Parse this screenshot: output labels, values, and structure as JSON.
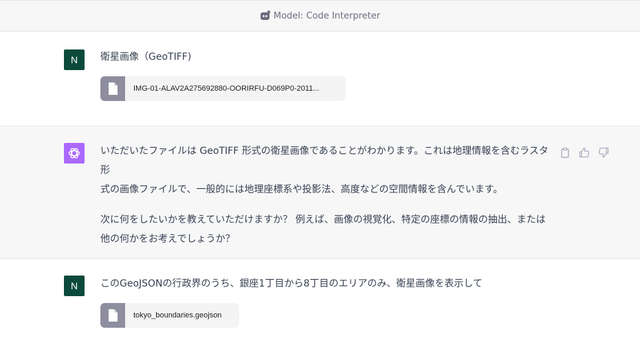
{
  "model_bar": {
    "label": "Model: Code Interpreter"
  },
  "messages": [
    {
      "role": "user",
      "avatar_letter": "N",
      "text": "衛星画像（GeoTIFF)",
      "attachment": "IMG-01-ALAV2A275692880-OORIRFU-D069P0-2011..."
    },
    {
      "role": "assistant",
      "paragraphs": [
        [
          "いただいたファイルは GeoTIFF 形式の衛星画像であることがわかります。これは地理情報を含むラスタ形",
          "式の画像ファイルで、一般的には地理座標系や投影法、高度などの空間情報を含んでいます。"
        ],
        [
          "次に何をしたいかを教えていただけますか？ 例えば、画像の視覚化、特定の座標の情報の抽出、または",
          "他の何かをお考えでしょうか？"
        ]
      ],
      "actions": [
        "clipboard-icon",
        "thumbs-up-icon",
        "thumbs-down-icon"
      ]
    },
    {
      "role": "user",
      "avatar_letter": "N",
      "text": "このGeoJSONの行政界のうち、銀座1丁目から8丁目のエリアのみ、衛星画像を表示して",
      "attachment": "tokyo_boundaries.geojson"
    }
  ],
  "colors": {
    "user_avatar": "#0b4a3a",
    "assistant_avatar": "#ab68ff",
    "assistant_bg": "#f7f7f8",
    "file_icon_bg": "#8e8ea0"
  }
}
